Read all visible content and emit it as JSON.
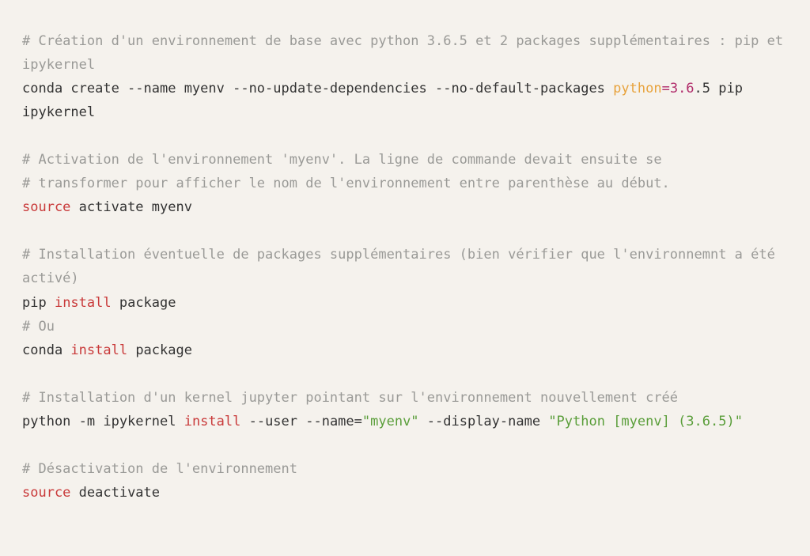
{
  "code": {
    "tokens": [
      {
        "cls": "tok-comment",
        "text": "# Création d'un environnement de base avec python 3.6.5 et 2 packages supplémentaires : pip et ipykernel"
      },
      {
        "cls": "nl",
        "text": "\n"
      },
      {
        "cls": "tok-plain",
        "text": "conda create --name myenv --no-update-dependencies --no-default-packages "
      },
      {
        "cls": "tok-keyword",
        "text": "python"
      },
      {
        "cls": "tok-operator",
        "text": "="
      },
      {
        "cls": "tok-number",
        "text": "3.6"
      },
      {
        "cls": "tok-plain",
        "text": ".5 pip ipykernel"
      },
      {
        "cls": "nl",
        "text": "\n"
      },
      {
        "cls": "nl",
        "text": "\n"
      },
      {
        "cls": "tok-comment",
        "text": "# Activation de l'environnement 'myenv'. La ligne de commande devait ensuite se"
      },
      {
        "cls": "nl",
        "text": "\n"
      },
      {
        "cls": "tok-comment",
        "text": "# transformer pour afficher le nom de l'environnement entre parenthèse au début."
      },
      {
        "cls": "nl",
        "text": "\n"
      },
      {
        "cls": "tok-builtin",
        "text": "source"
      },
      {
        "cls": "tok-plain",
        "text": " activate myenv"
      },
      {
        "cls": "nl",
        "text": "\n"
      },
      {
        "cls": "nl",
        "text": "\n"
      },
      {
        "cls": "tok-comment",
        "text": "# Installation éventuelle de packages supplémentaires (bien vérifier que l'environnemnt a été activé)"
      },
      {
        "cls": "nl",
        "text": "\n"
      },
      {
        "cls": "tok-plain",
        "text": "pip "
      },
      {
        "cls": "tok-builtin",
        "text": "install"
      },
      {
        "cls": "tok-plain",
        "text": " package"
      },
      {
        "cls": "nl",
        "text": "\n"
      },
      {
        "cls": "tok-comment",
        "text": "# Ou"
      },
      {
        "cls": "nl",
        "text": "\n"
      },
      {
        "cls": "tok-plain",
        "text": "conda "
      },
      {
        "cls": "tok-builtin",
        "text": "install"
      },
      {
        "cls": "tok-plain",
        "text": " package"
      },
      {
        "cls": "nl",
        "text": "\n"
      },
      {
        "cls": "nl",
        "text": "\n"
      },
      {
        "cls": "tok-comment",
        "text": "# Installation d'un kernel jupyter pointant sur l'environnement nouvellement créé"
      },
      {
        "cls": "nl",
        "text": "\n"
      },
      {
        "cls": "tok-plain",
        "text": "python -m ipykernel "
      },
      {
        "cls": "tok-builtin",
        "text": "install"
      },
      {
        "cls": "tok-plain",
        "text": " --user --name="
      },
      {
        "cls": "tok-string",
        "text": "\"myenv\""
      },
      {
        "cls": "tok-plain",
        "text": " --display-name "
      },
      {
        "cls": "tok-string",
        "text": "\"Python [myenv] (3.6.5)\""
      },
      {
        "cls": "nl",
        "text": "\n"
      },
      {
        "cls": "nl",
        "text": "\n"
      },
      {
        "cls": "tok-comment",
        "text": "# Désactivation de l'environnement"
      },
      {
        "cls": "nl",
        "text": "\n"
      },
      {
        "cls": "tok-builtin",
        "text": "source"
      },
      {
        "cls": "tok-plain",
        "text": " deactivate"
      }
    ]
  }
}
